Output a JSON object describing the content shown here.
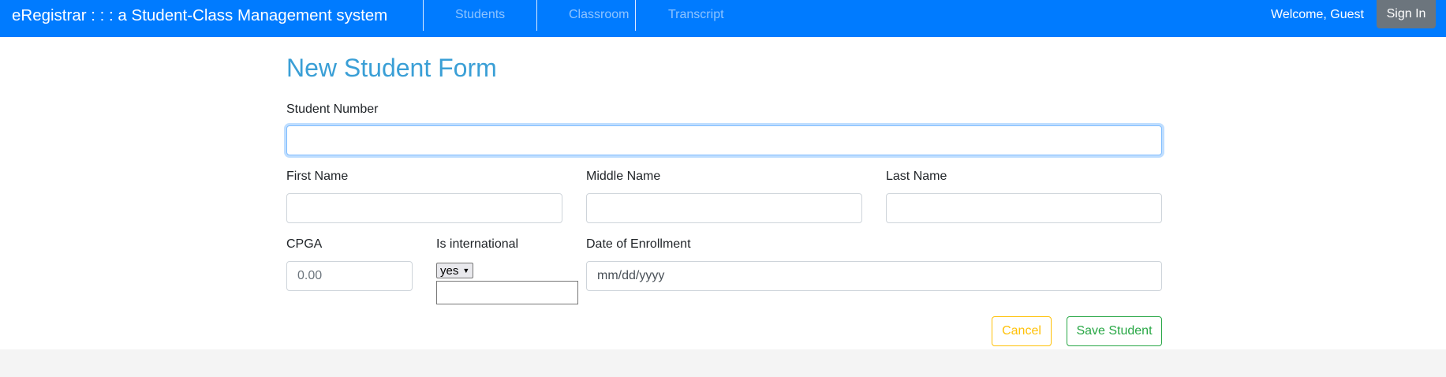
{
  "navbar": {
    "brand": "eRegistrar : : : a Student-Class Management system",
    "links": [
      "Students",
      "Classroom",
      "Transcript"
    ],
    "welcome": "Welcome, Guest",
    "signin_label": "Sign In"
  },
  "form": {
    "title": "New Student Form",
    "student_number": {
      "label": "Student Number",
      "value": ""
    },
    "first_name": {
      "label": "First Name",
      "value": ""
    },
    "middle_name": {
      "label": "Middle Name",
      "value": ""
    },
    "last_name": {
      "label": "Last Name",
      "value": ""
    },
    "cpga": {
      "label": "CPGA",
      "placeholder": "0.00"
    },
    "is_international": {
      "label": "Is international",
      "selected": "yes"
    },
    "enrollment_date": {
      "label": "Date of Enrollment",
      "placeholder": "mm/dd/yyyy"
    },
    "cancel_label": "Cancel",
    "save_label": "Save Student"
  },
  "colors": {
    "navbar": "#007bff",
    "title": "#3a9fd6",
    "cancel": "#ffc107",
    "save": "#28a745"
  }
}
